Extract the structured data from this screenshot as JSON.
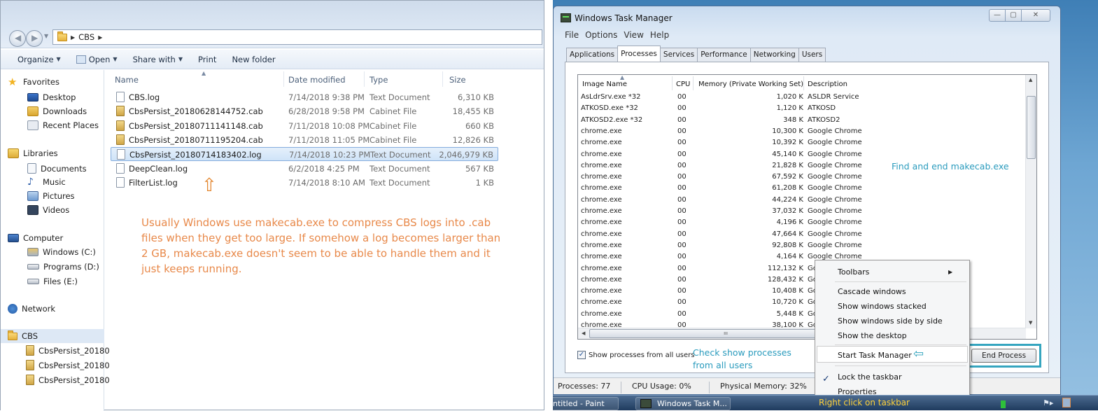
{
  "explorer": {
    "breadcrumb": [
      "CBS"
    ],
    "toolbar": {
      "organize": "Organize",
      "open": "Open",
      "share": "Share with",
      "print": "Print",
      "new_folder": "New folder"
    },
    "columns": {
      "name": "Name",
      "date": "Date modified",
      "type": "Type",
      "size": "Size"
    },
    "files": [
      {
        "name": "CBS.log",
        "date": "7/14/2018 9:38 PM",
        "type": "Text Document",
        "size": "6,310 KB",
        "icon": "log-icon"
      },
      {
        "name": "CbsPersist_20180628144752.cab",
        "date": "6/28/2018 9:58 PM",
        "type": "Cabinet File",
        "size": "18,455 KB",
        "icon": "cab-icon"
      },
      {
        "name": "CbsPersist_20180711141148.cab",
        "date": "7/11/2018 10:08 PM",
        "type": "Cabinet File",
        "size": "660 KB",
        "icon": "cab-icon"
      },
      {
        "name": "CbsPersist_20180711195204.cab",
        "date": "7/11/2018 11:05 PM",
        "type": "Cabinet File",
        "size": "12,826 KB",
        "icon": "cab-icon"
      },
      {
        "name": "CbsPersist_20180714183402.log",
        "date": "7/14/2018 10:23 PM",
        "type": "Text Document",
        "size": "2,046,979 KB",
        "icon": "log-icon",
        "selected": true
      },
      {
        "name": "DeepClean.log",
        "date": "6/2/2018 4:25 PM",
        "type": "Text Document",
        "size": "567 KB",
        "icon": "log-icon"
      },
      {
        "name": "FilterList.log",
        "date": "7/14/2018 8:10 AM",
        "type": "Text Document",
        "size": "1 KB",
        "icon": "log-icon"
      }
    ],
    "nav": {
      "favorites": "Favorites",
      "desktop": "Desktop",
      "downloads": "Downloads",
      "recent": "Recent Places",
      "libraries": "Libraries",
      "documents": "Documents",
      "music": "Music",
      "pictures": "Pictures",
      "videos": "Videos",
      "computer": "Computer",
      "drive_c": "Windows (C:)",
      "drive_d": "Programs (D:)",
      "drive_e": "Files (E:)",
      "network": "Network",
      "cbs": "CBS",
      "cbs_children": [
        "CbsPersist_20180",
        "CbsPersist_20180",
        "CbsPersist_20180"
      ]
    },
    "note": "Usually Windows use makecab.exe to compress CBS logs into .cab files when they get too large. If somehow a log becomes larger than 2 GB, makecab.exe doesn't seem to be able to handle them and it just keeps running.",
    "note_color": "#e8894a"
  },
  "taskmgr": {
    "title": "Windows Task Manager",
    "menu": [
      "File",
      "Options",
      "View",
      "Help"
    ],
    "tabs": [
      "Applications",
      "Processes",
      "Services",
      "Performance",
      "Networking",
      "Users"
    ],
    "active_tab": "Processes",
    "columns": {
      "name": "Image Name",
      "cpu": "CPU",
      "mem": "Memory (Private Working Set)",
      "desc": "Description"
    },
    "processes": [
      {
        "name": "AsLdrSrv.exe *32",
        "cpu": "00",
        "mem": "1,020 K",
        "desc": "ASLDR Service"
      },
      {
        "name": "ATKOSD.exe *32",
        "cpu": "00",
        "mem": "1,120 K",
        "desc": "ATKOSD"
      },
      {
        "name": "ATKOSD2.exe *32",
        "cpu": "00",
        "mem": "348 K",
        "desc": "ATKOSD2"
      },
      {
        "name": "chrome.exe",
        "cpu": "00",
        "mem": "10,300 K",
        "desc": "Google Chrome"
      },
      {
        "name": "chrome.exe",
        "cpu": "00",
        "mem": "10,392 K",
        "desc": "Google Chrome"
      },
      {
        "name": "chrome.exe",
        "cpu": "00",
        "mem": "45,140 K",
        "desc": "Google Chrome"
      },
      {
        "name": "chrome.exe",
        "cpu": "00",
        "mem": "21,828 K",
        "desc": "Google Chrome"
      },
      {
        "name": "chrome.exe",
        "cpu": "00",
        "mem": "67,592 K",
        "desc": "Google Chrome"
      },
      {
        "name": "chrome.exe",
        "cpu": "00",
        "mem": "61,208 K",
        "desc": "Google Chrome"
      },
      {
        "name": "chrome.exe",
        "cpu": "00",
        "mem": "44,224 K",
        "desc": "Google Chrome"
      },
      {
        "name": "chrome.exe",
        "cpu": "00",
        "mem": "37,032 K",
        "desc": "Google Chrome"
      },
      {
        "name": "chrome.exe",
        "cpu": "00",
        "mem": "4,196 K",
        "desc": "Google Chrome"
      },
      {
        "name": "chrome.exe",
        "cpu": "00",
        "mem": "47,664 K",
        "desc": "Google Chrome"
      },
      {
        "name": "chrome.exe",
        "cpu": "00",
        "mem": "92,808 K",
        "desc": "Google Chrome"
      },
      {
        "name": "chrome.exe",
        "cpu": "00",
        "mem": "4,164 K",
        "desc": "Google Chrome"
      },
      {
        "name": "chrome.exe",
        "cpu": "00",
        "mem": "112,132 K",
        "desc": "Go"
      },
      {
        "name": "chrome.exe",
        "cpu": "00",
        "mem": "128,432 K",
        "desc": "Go"
      },
      {
        "name": "chrome.exe",
        "cpu": "00",
        "mem": "10,408 K",
        "desc": "Go"
      },
      {
        "name": "chrome.exe",
        "cpu": "00",
        "mem": "10,720 K",
        "desc": "Go"
      },
      {
        "name": "chrome.exe",
        "cpu": "00",
        "mem": "5,448 K",
        "desc": "Go"
      },
      {
        "name": "chrome.exe",
        "cpu": "00",
        "mem": "38,100 K",
        "desc": "Go"
      }
    ],
    "show_all_label": "Show processes from all users",
    "show_all_checked": true,
    "end_process": "End Process",
    "status": {
      "processes": "Processes: 77",
      "cpu": "CPU Usage: 0%",
      "memory": "Physical Memory: 32%"
    },
    "find_note": "Find and end makecab.exe",
    "check_note": "Check show processes from all users",
    "note_color": "#2a9bbd"
  },
  "context_menu": {
    "toolbars": "Toolbars",
    "cascade": "Cascade windows",
    "stacked": "Show windows stacked",
    "side_by_side": "Show windows side by side",
    "desktop": "Show the desktop",
    "start_tm": "Start Task Manager",
    "lock": "Lock the taskbar",
    "lock_checked": true,
    "properties": "Properties"
  },
  "taskbar": {
    "paint": "ntitled - Paint",
    "taskmgr": "Windows Task M...",
    "note": "Right click on taskbar",
    "note_color": "#ffd23a"
  }
}
